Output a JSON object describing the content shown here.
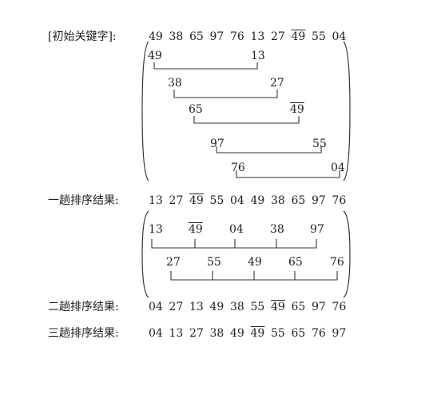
{
  "labels": {
    "initial": "[初始关键字]:",
    "pass1": "一趟排序结果:",
    "pass2": "二趟排序结果:",
    "pass3": "三趟排序结果:"
  },
  "rows": {
    "initial": [
      "49",
      "38",
      "65",
      "97",
      "76",
      "13",
      "27",
      "49",
      "55",
      "04"
    ],
    "pass1": [
      "13",
      "27",
      "49",
      "55",
      "04",
      "49",
      "38",
      "65",
      "97",
      "76"
    ],
    "pass2": [
      "04",
      "27",
      "13",
      "49",
      "38",
      "55",
      "49",
      "65",
      "97",
      "76"
    ],
    "pass3": [
      "04",
      "13",
      "27",
      "38",
      "49",
      "49",
      "55",
      "65",
      "76",
      "97"
    ]
  },
  "overlined_index": {
    "initial": 7,
    "pass1": 2,
    "pass2": 6,
    "pass3": 5
  },
  "groups1": [
    {
      "a": "49",
      "b": "13",
      "a_overline": false,
      "b_overline": false
    },
    {
      "a": "38",
      "b": "27",
      "a_overline": false,
      "b_overline": false
    },
    {
      "a": "65",
      "b": "49",
      "a_overline": false,
      "b_overline": true
    },
    {
      "a": "97",
      "b": "55",
      "a_overline": false,
      "b_overline": false
    },
    {
      "a": "76",
      "b": "04",
      "a_overline": false,
      "b_overline": false
    }
  ],
  "groups2": [
    {
      "values": [
        "13",
        "49",
        "04",
        "38",
        "97"
      ],
      "overlined": [
        1
      ]
    },
    {
      "values": [
        "27",
        "55",
        "49",
        "65",
        "76"
      ],
      "overlined": []
    }
  ]
}
